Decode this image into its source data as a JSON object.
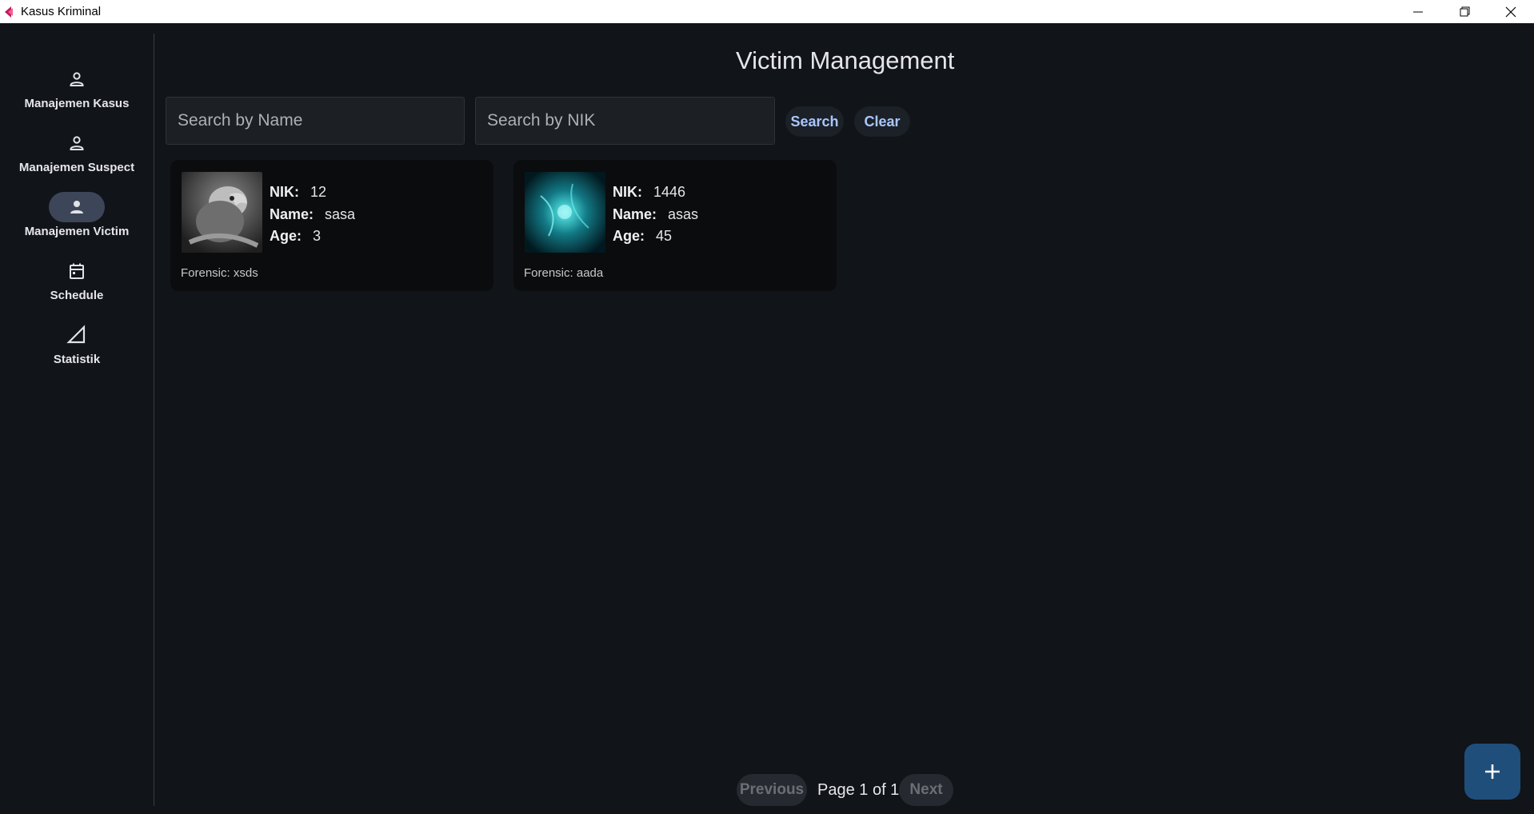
{
  "window": {
    "title": "Kasus Kriminal"
  },
  "sidebar": {
    "items": [
      {
        "label": "Manajemen Kasus",
        "icon": "person-icon",
        "active": false
      },
      {
        "label": "Manajemen Suspect",
        "icon": "person-icon",
        "active": false
      },
      {
        "label": "Manajemen Victim",
        "icon": "person-filled-icon",
        "active": true
      },
      {
        "label": "Schedule",
        "icon": "calendar-icon",
        "active": false
      },
      {
        "label": "Statistik",
        "icon": "chart-triangle-icon",
        "active": false
      }
    ]
  },
  "header": {
    "title": "Victim Management"
  },
  "search": {
    "name_placeholder": "Search by Name",
    "name_value": "",
    "nik_placeholder": "Search by NIK",
    "nik_value": "",
    "search_label": "Search",
    "clear_label": "Clear"
  },
  "victims": [
    {
      "nik_label": "NIK:",
      "nik": "12",
      "name_label": "Name:",
      "name": "sasa",
      "age_label": "Age:",
      "age": "3",
      "forensic": "Forensic: xsds",
      "photo": "parrot-grayscale"
    },
    {
      "nik_label": "NIK:",
      "nik": "1446",
      "name_label": "Name:",
      "name": "asas",
      "age_label": "Age:",
      "age": "45",
      "forensic": "Forensic: aada",
      "photo": "teal-nebula"
    }
  ],
  "pagination": {
    "previous_label": "Previous",
    "page_text": "Page 1 of 1",
    "next_label": "Next"
  },
  "fab": {
    "icon": "plus-icon"
  },
  "colors": {
    "background": "#111418",
    "accent": "#a9c7ff",
    "fab": "#1f4e7a",
    "active_pill": "#3c4658"
  }
}
